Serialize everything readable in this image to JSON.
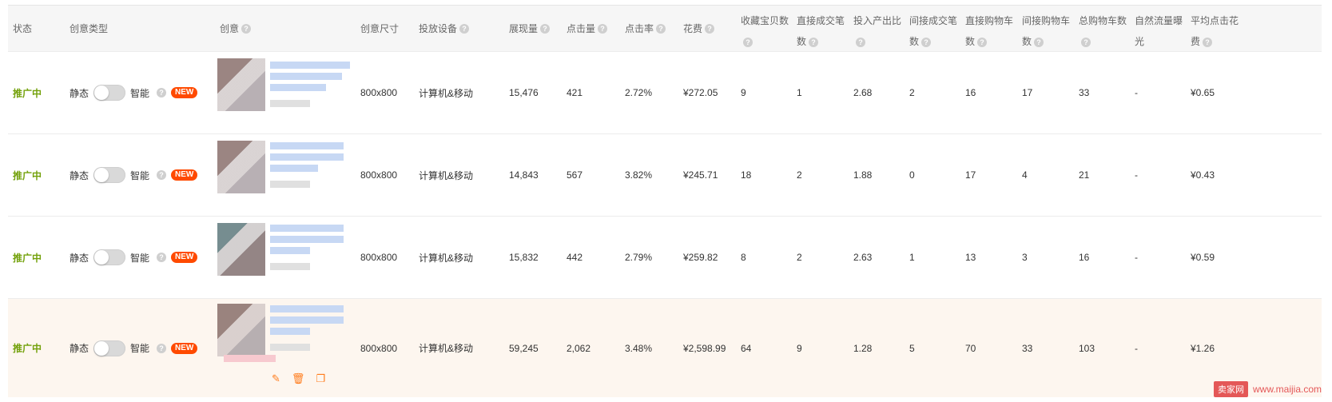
{
  "headers": [
    {
      "label": "状态",
      "help": false
    },
    {
      "label": "创意类型",
      "help": false
    },
    {
      "label": "创意",
      "help": true
    },
    {
      "label": "创意尺寸",
      "help": false
    },
    {
      "label": "投放设备",
      "help": true
    },
    {
      "label": "展现量",
      "help": true
    },
    {
      "label": "点击量",
      "help": true
    },
    {
      "label": "点击率",
      "help": true
    },
    {
      "label": "花费",
      "help": true
    },
    {
      "label": "收藏宝贝数",
      "help": true
    },
    {
      "label": "直接成交笔数",
      "help": true
    },
    {
      "label": "投入产出比",
      "help": true
    },
    {
      "label": "间接成交笔数",
      "help": true
    },
    {
      "label": "直接购物车数",
      "help": true
    },
    {
      "label": "间接购物车数",
      "help": true
    },
    {
      "label": "总购物车数",
      "help": true
    },
    {
      "label": "自然流量曝光",
      "help": false
    },
    {
      "label": "平均点击花费",
      "help": true
    }
  ],
  "type_labels": {
    "static": "静态",
    "smart": "智能",
    "new_badge": "NEW"
  },
  "rows": [
    {
      "status": "推广中",
      "size": "800x800",
      "device": "计算机&移动",
      "impressions": "15,476",
      "clicks": "421",
      "ctr": "2.72%",
      "cost": "¥272.05",
      "fav": "9",
      "direct_orders": "1",
      "roi": "2.68",
      "indirect_orders": "2",
      "direct_cart": "16",
      "indirect_cart": "17",
      "total_cart": "33",
      "natural": "-",
      "avg_cpc": "¥0.65"
    },
    {
      "status": "推广中",
      "size": "800x800",
      "device": "计算机&移动",
      "impressions": "14,843",
      "clicks": "567",
      "ctr": "3.82%",
      "cost": "¥245.71",
      "fav": "18",
      "direct_orders": "2",
      "roi": "1.88",
      "indirect_orders": "0",
      "direct_cart": "17",
      "indirect_cart": "4",
      "total_cart": "21",
      "natural": "-",
      "avg_cpc": "¥0.43"
    },
    {
      "status": "推广中",
      "size": "800x800",
      "device": "计算机&移动",
      "impressions": "15,832",
      "clicks": "442",
      "ctr": "2.79%",
      "cost": "¥259.82",
      "fav": "8",
      "direct_orders": "2",
      "roi": "2.63",
      "indirect_orders": "1",
      "direct_cart": "13",
      "indirect_cart": "3",
      "total_cart": "16",
      "natural": "-",
      "avg_cpc": "¥0.59"
    },
    {
      "status": "推广中",
      "size": "800x800",
      "device": "计算机&移动",
      "impressions": "59,245",
      "clicks": "2,062",
      "ctr": "3.48%",
      "cost": "¥2,598.99",
      "fav": "64",
      "direct_orders": "9",
      "roi": "1.28",
      "indirect_orders": "5",
      "direct_cart": "70",
      "indirect_cart": "33",
      "total_cart": "103",
      "natural": "-",
      "avg_cpc": "¥1.26"
    }
  ],
  "row_actions": {
    "edit_icon": "pencil-icon",
    "delete_icon": "trash-icon",
    "copy_icon": "copy-icon"
  },
  "watermark": {
    "logo": "卖家网",
    "url": "www.maijia.com"
  }
}
